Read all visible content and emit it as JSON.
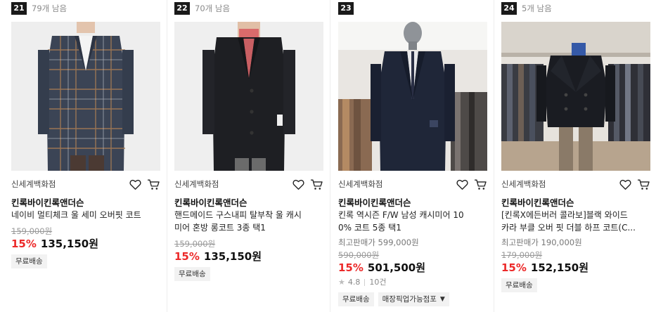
{
  "products": [
    {
      "rank": "21",
      "remaining": "79개 남음",
      "store": "신세계백화점",
      "brand": "킨록바이킨록앤더슨",
      "title_lines": [
        "네이비 멀티체크 울 세미 오버핏 코트"
      ],
      "original_price": "159,000원",
      "discount": "15%",
      "price": "135,150원",
      "badges": [
        "무료배송"
      ],
      "image_desc": "plaid-overcoat-photo"
    },
    {
      "rank": "22",
      "remaining": "70개 남음",
      "store": "신세계백화점",
      "brand": "킨록바이킨록앤더슨",
      "title_lines": [
        "핸드메이드 구스내피 탈부착 울 캐시",
        "미어 혼방 롱코트 3종 택1"
      ],
      "original_price": "159,000원",
      "discount": "15%",
      "price": "135,150원",
      "badges": [
        "무료배송"
      ],
      "image_desc": "black-longcoat-photo"
    },
    {
      "rank": "23",
      "remaining": "",
      "store": "신세계백화점",
      "brand": "킨록바이킨록앤더슨",
      "title_lines": [
        "킨록 역시즌 F/W 남성 캐시미어 10",
        "0% 코트 5종 택1"
      ],
      "reference_price": "최고판매가 599,000원",
      "original_price": "590,000원",
      "discount": "15%",
      "price": "501,500원",
      "rating": "4.8",
      "review_count": "10건",
      "badges": [
        "무료배송",
        "매장픽업가능점포"
      ],
      "image_desc": "navy-coat-mannequin-photo"
    },
    {
      "rank": "24",
      "remaining": "5개 남음",
      "store": "신세계백화점",
      "brand": "킨록바이킨록앤더슨",
      "title_lines": [
        "[킨록X에든버러 콜라보]블랙 와이드",
        "카라 부클 오버 핏 더블 하프 코트(C..."
      ],
      "reference_price": "최고판매가 190,000원",
      "original_price": "179,000원",
      "discount": "15%",
      "price": "152,150원",
      "badges": [
        "무료배송"
      ],
      "image_desc": "peacoat-store-photo"
    }
  ],
  "colors": {
    "discount": "#ec2a2a",
    "rank_bg": "#1a1a1a",
    "badge_bg": "#f2f2f2"
  },
  "icons": [
    "heart-icon",
    "cart-icon",
    "star-icon",
    "dropdown-caret-icon"
  ]
}
